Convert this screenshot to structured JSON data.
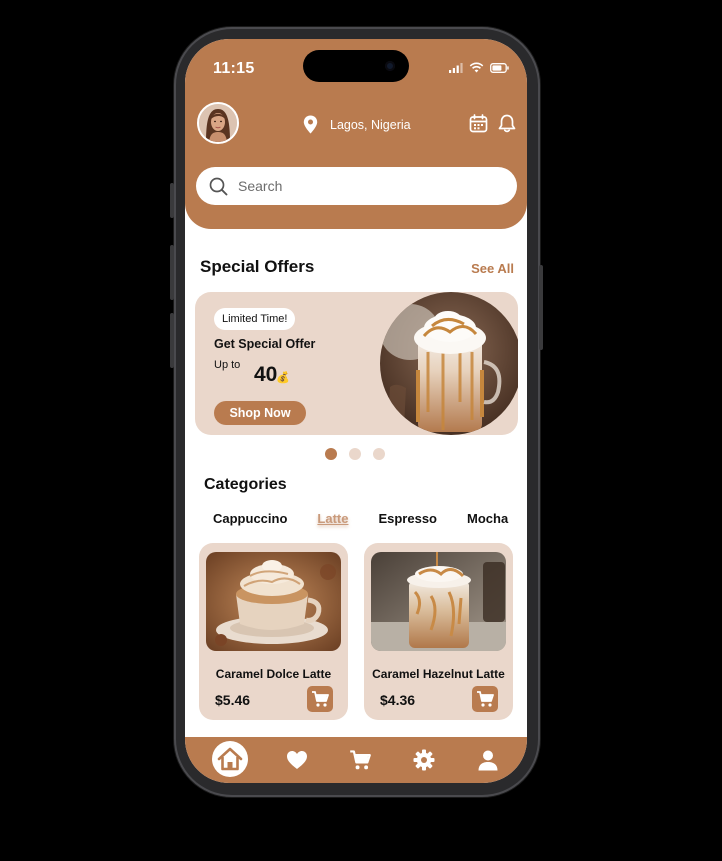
{
  "status_bar": {
    "time": "11:15"
  },
  "header": {
    "location": "Lagos, Nigeria",
    "search": {
      "placeholder": "Search",
      "value": ""
    }
  },
  "special_offers": {
    "title": "Special Offers",
    "see_all": "See All",
    "badge": "Limited Time!",
    "offer_title": "Get Special Offer",
    "up_to": "Up to",
    "percent": "40",
    "button": "Shop Now",
    "carousel_pages": 3,
    "carousel_active": 1
  },
  "categories": {
    "title": "Categories",
    "items": [
      {
        "label": "Cappuccino",
        "active": false
      },
      {
        "label": "Latte",
        "active": true
      },
      {
        "label": "Espresso",
        "active": false
      },
      {
        "label": "Mocha",
        "active": false
      }
    ]
  },
  "products": [
    {
      "name": "Caramel Dolce Latte",
      "price": "$5.46"
    },
    {
      "name": "Caramel Hazelnut Latte",
      "price": "$4.36"
    }
  ],
  "bottom_nav": {
    "items": [
      "home-icon",
      "heart-icon",
      "cart-icon",
      "gear-icon",
      "user-icon"
    ],
    "active": "home-icon"
  },
  "colors": {
    "accent": "#b97b4f",
    "card": "#ead7cb",
    "background": "#ffffff"
  }
}
